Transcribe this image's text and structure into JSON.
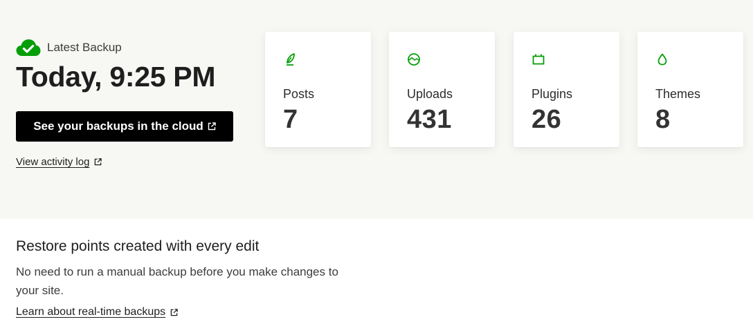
{
  "header": {
    "latest_label": "Latest Backup",
    "backup_time": "Today, 9:25 PM",
    "cloud_button_label": "See your backups in the cloud",
    "activity_link": "View activity log"
  },
  "stats": [
    {
      "label": "Posts",
      "value": "7",
      "icon": "leaf-icon"
    },
    {
      "label": "Uploads",
      "value": "431",
      "icon": "image-icon"
    },
    {
      "label": "Plugins",
      "value": "26",
      "icon": "plugin-icon"
    },
    {
      "label": "Themes",
      "value": "8",
      "icon": "drop-icon"
    }
  ],
  "restore": {
    "title": "Restore points created with every edit",
    "description": "No need to run a manual backup before you make changes to your site.",
    "link": "Learn about real-time backups"
  },
  "colors": {
    "accent_green": "#069e08",
    "button_bg": "#000000",
    "top_bg": "#f7f7f4"
  }
}
